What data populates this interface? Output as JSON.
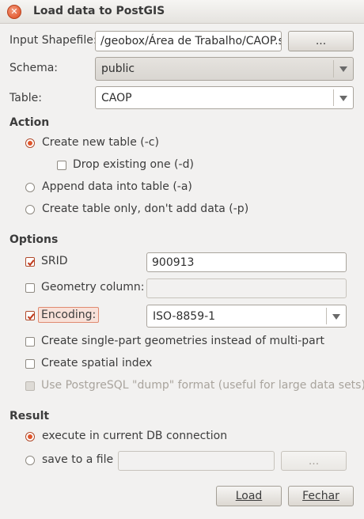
{
  "window": {
    "title": "Load data to PostGIS"
  },
  "input_shapefile": {
    "label": "Input Shapefile:",
    "value": "/geobox/Área de Trabalho/CAOP.shp",
    "browse_label": "..."
  },
  "schema": {
    "label": "Schema:",
    "value": "public"
  },
  "table": {
    "label": "Table:",
    "value": "CAOP"
  },
  "action": {
    "heading": "Action",
    "create_new": "Create new table (-c)",
    "drop_existing": "Drop existing one (-d)",
    "append": "Append data into table (-a)",
    "create_only": "Create table only, don't add data (-p)"
  },
  "options": {
    "heading": "Options",
    "srid_label": "SRID",
    "srid_value": "900913",
    "geometry_label": "Geometry column:",
    "geometry_value": "",
    "encoding_label": "Encoding:",
    "encoding_value": "ISO-8859-1",
    "single_part": "Create single-part geometries instead of multi-part",
    "spatial_index": "Create spatial index",
    "dump_format": "Use PostgreSQL \"dump\" format (useful for large data sets)"
  },
  "result": {
    "heading": "Result",
    "execute": "execute in current DB connection",
    "save_to_file": "save to a file",
    "file_value": "",
    "browse_label": "..."
  },
  "buttons": {
    "load": "Load",
    "close": "Fechar"
  },
  "colors": {
    "accent": "#e0562c",
    "window_bg": "#f2f1f0"
  }
}
